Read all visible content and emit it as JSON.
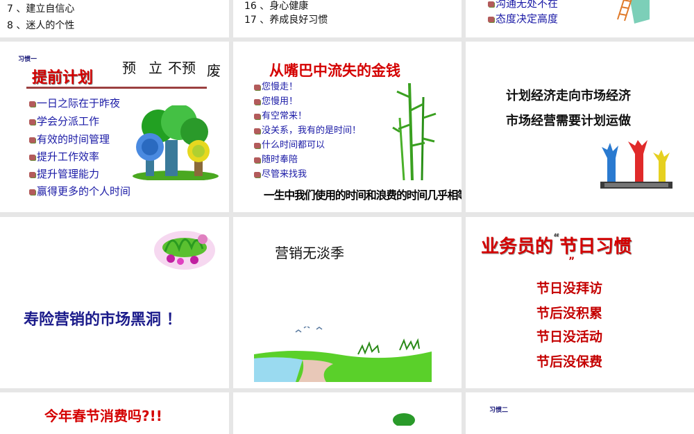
{
  "row0": {
    "left_lines": [
      "7 、建立自信心",
      "8 、迷人的个性"
    ],
    "mid_lines": [
      "16 、身心健康",
      "17 、养成良好习惯"
    ],
    "right_lines": [
      "沟通无处不在",
      "态度决定高度"
    ]
  },
  "slide_plan": {
    "tag": "习惯一",
    "title": "提前计划",
    "hand_text": [
      "预",
      "立",
      "不预",
      "废"
    ],
    "items": [
      "一日之际在于昨夜",
      "学会分派工作",
      "有效的时间管理",
      "提升工作效率",
      "提升管理能力",
      "赢得更多的个人时间"
    ]
  },
  "slide_money": {
    "title": "从嘴巴中流失的金钱",
    "items": [
      "您慢走！",
      "您慢用！",
      "有空常来！",
      "没关系，我有的是时间！",
      "什么时间都可以",
      "随时奉陪",
      "尽管来找我"
    ],
    "bottom": "一生中我们使用的时间和浪费的时间几乎相等"
  },
  "slide_economy": {
    "lines": [
      "计划经济走向市场经济",
      "市场经营需要计划运做"
    ]
  },
  "slide_blackhole": {
    "text": "寿险营销的市场黑洞 ！"
  },
  "slide_season": {
    "text": "营销无淡季"
  },
  "slide_holiday": {
    "title_a": "业务员的",
    "quote_open": "“",
    "title_b": "节日习惯",
    "quote_close": "”",
    "items": [
      "节日没拜访",
      "节后没积累",
      "节日没活动",
      "节后没保费"
    ]
  },
  "row3": {
    "left_title": "今年春节消费吗?!!",
    "right_tag": "习惯二"
  },
  "colors": {
    "title_red": "#d40000",
    "list_blue": "#1a1aa6",
    "bg_gray": "#e6e6e6"
  }
}
